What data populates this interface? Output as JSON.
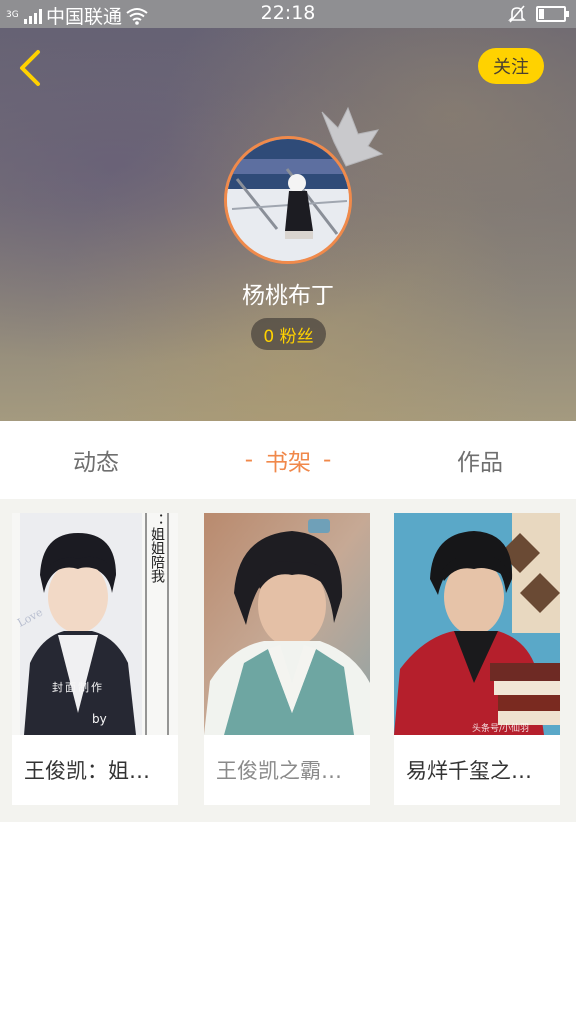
{
  "status_bar": {
    "network": "3G",
    "carrier": "中国联通",
    "time": "22:18",
    "icons": [
      "signal-icon",
      "wifi-icon",
      "mute-bell-icon",
      "battery-icon"
    ]
  },
  "header": {
    "follow_label": "关注",
    "nickname": "杨桃布丁",
    "fans_label": "0 粉丝",
    "colors": {
      "accent": "#ffd200",
      "avatar_ring": "#f08a4b"
    }
  },
  "tabs": [
    {
      "label": "动态",
      "active": false
    },
    {
      "label": "书架",
      "active": true,
      "dash": "-"
    },
    {
      "label": "作品",
      "active": false
    }
  ],
  "shelf": {
    "books": [
      {
        "title": "王俊凯：姐…",
        "cover_text": {
          "vertical": "王俊凯：姐姐陪我",
          "made_by": "封面制作",
          "by": "by",
          "deco": "Love"
        }
      },
      {
        "title": "王俊凯之霸…"
      },
      {
        "title": "易烊千玺之…",
        "cover_text": {
          "watermark": "头条号/小仙羽"
        }
      }
    ]
  },
  "colors": {
    "active_tab": "#f0884a",
    "shelf_bg": "#f3f3ef"
  }
}
